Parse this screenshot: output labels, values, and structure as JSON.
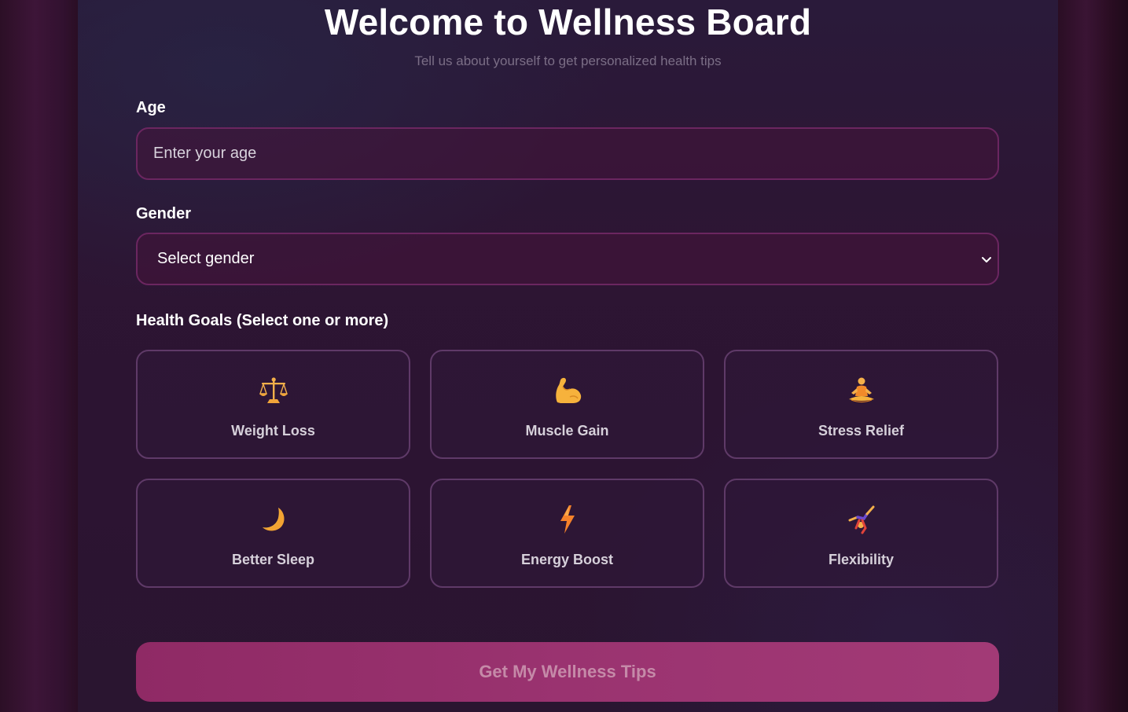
{
  "header": {
    "title": "Welcome to Wellness Board",
    "subtitle": "Tell us about yourself to get personalized health tips"
  },
  "form": {
    "age": {
      "label": "Age",
      "placeholder": "Enter your age",
      "value": ""
    },
    "gender": {
      "label": "Gender",
      "selected": "Select gender"
    },
    "goals": {
      "label": "Health Goals (Select one or more)",
      "items": [
        {
          "label": "Weight Loss",
          "icon": "balance-scale-icon"
        },
        {
          "label": "Muscle Gain",
          "icon": "flexed-biceps-icon"
        },
        {
          "label": "Stress Relief",
          "icon": "meditation-icon"
        },
        {
          "label": "Better Sleep",
          "icon": "crescent-moon-icon"
        },
        {
          "label": "Energy Boost",
          "icon": "lightning-bolt-icon"
        },
        {
          "label": "Flexibility",
          "icon": "cartwheel-icon"
        }
      ]
    },
    "submit_label": "Get My Wellness Tips"
  },
  "colors": {
    "accent": "#9a3370",
    "field_border": "#6b2660",
    "card_border": "#5f3a68",
    "icon_orange": "#f4a33a"
  }
}
